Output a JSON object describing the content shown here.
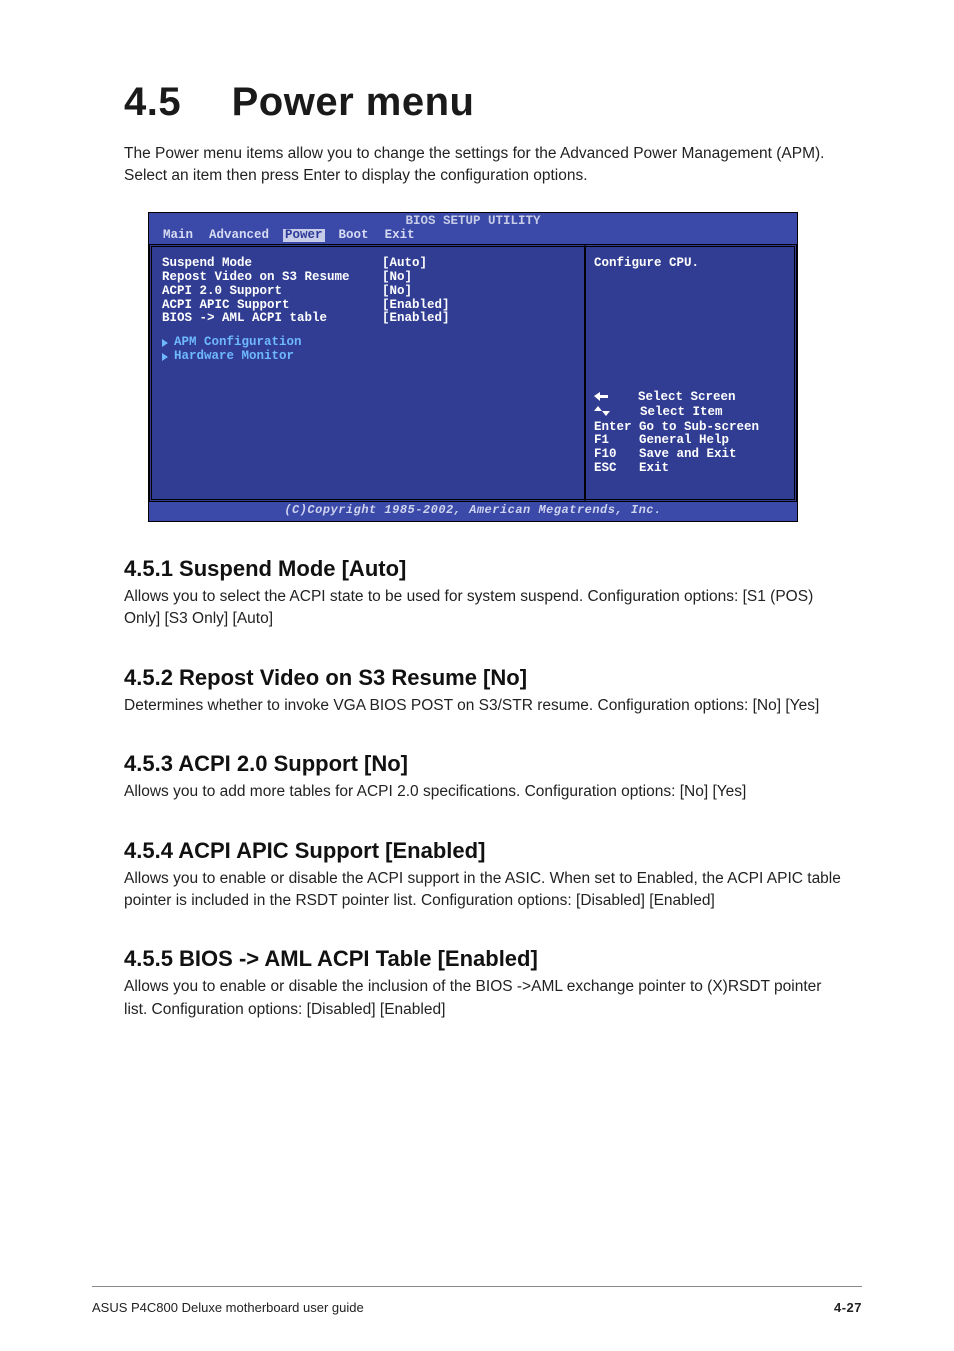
{
  "heading": {
    "num": "4.5",
    "title": "Power menu"
  },
  "intro": "The Power menu items allow you to change the settings for the Advanced Power Management (APM). Select an item then press Enter to display the configuration options.",
  "bios": {
    "title": "BIOS SETUP UTILITY",
    "tabs": [
      "Main",
      "Advanced",
      "Power",
      "Boot",
      "Exit"
    ],
    "selected_tab": "Power",
    "rows": [
      {
        "label": "Suspend Mode",
        "value": "[Auto]"
      },
      {
        "label": "Repost Video on S3 Resume",
        "value": "[No]"
      },
      {
        "label": "ACPI 2.0 Support",
        "value": "[No]"
      },
      {
        "label": "ACPI APIC Support",
        "value": "[Enabled]"
      },
      {
        "label": "BIOS -> AML ACPI table",
        "value": "[Enabled]"
      }
    ],
    "submenus": [
      "APM Configuration",
      "Hardware Monitor"
    ],
    "help_top": "Configure CPU.",
    "help_nav": [
      {
        "key": "←",
        "text": "Select Screen"
      },
      {
        "key": "↑↓",
        "text": "Select Item"
      },
      {
        "key": "Enter",
        "text": "Go to Sub-screen"
      },
      {
        "key": "F1",
        "text": "General Help"
      },
      {
        "key": "F10",
        "text": "Save and Exit"
      },
      {
        "key": "ESC",
        "text": "Exit"
      }
    ],
    "footer": "(C)Copyright 1985-2002, American Megatrends, Inc."
  },
  "sections": [
    {
      "title": "4.5.1  Suspend Mode [Auto]",
      "desc": "Allows you to select the ACPI state to be used for system suspend. Configuration options: [S1 (POS) Only] [S3 Only] [Auto]"
    },
    {
      "title": "4.5.2  Repost Video on S3 Resume [No]",
      "desc": "Determines whether to invoke VGA BIOS POST on S3/STR resume. Configuration options: [No] [Yes]"
    },
    {
      "title": "4.5.3  ACPI 2.0 Support [No]",
      "desc": "Allows you to add more tables for ACPI 2.0 specifications. Configuration options: [No] [Yes]"
    },
    {
      "title": "4.5.4  ACPI APIC Support [Enabled]",
      "desc": "Allows you to enable or disable the ACPI support in the ASIC. When set to Enabled, the ACPI APIC table pointer is included in the RSDT pointer list. Configuration options: [Disabled] [Enabled]"
    },
    {
      "title": "4.5.5  BIOS -> AML ACPI Table [Enabled]",
      "desc": "Allows you to enable or disable the inclusion of the BIOS ->AML exchange pointer to (X)RSDT pointer list. Configuration options: [Disabled] [Enabled]"
    }
  ],
  "page_footer": {
    "left": "ASUS P4C800 Deluxe motherboard user guide",
    "right": "4-27"
  }
}
